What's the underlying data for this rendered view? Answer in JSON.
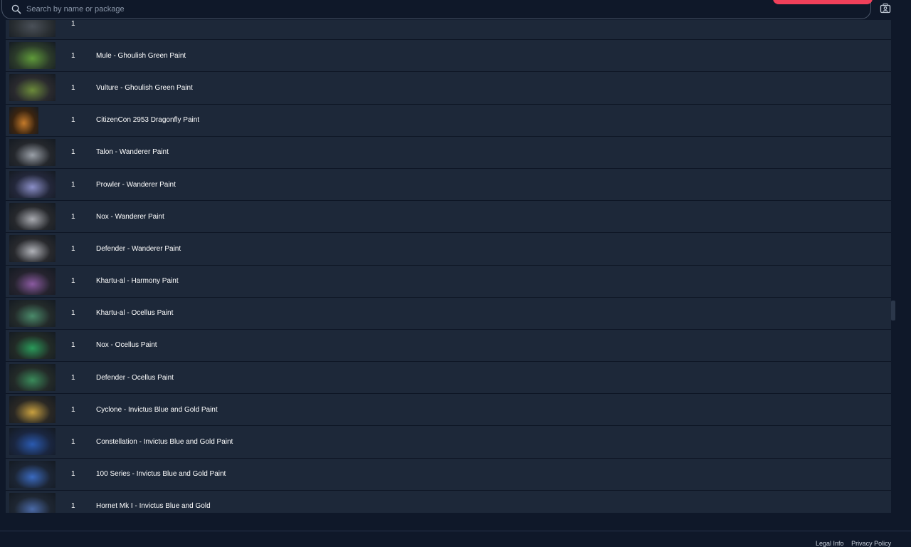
{
  "search": {
    "placeholder": "Search by name or package"
  },
  "colors": {
    "accent": "#f0405a",
    "row_bg": "#1d2839",
    "page_bg": "#0f1829"
  },
  "icons": {
    "search": "search-icon",
    "profile": "profile-card-icon"
  },
  "items": [
    {
      "qty": "1",
      "name": "",
      "thumb": [
        "#2a2f33",
        "#4a5058"
      ]
    },
    {
      "qty": "1",
      "name": "Mule - Ghoulish Green Paint",
      "thumb": [
        "#2b3a2a",
        "#5f9a3a"
      ]
    },
    {
      "qty": "1",
      "name": "Vulture - Ghoulish Green Paint",
      "thumb": [
        "#2a2a2e",
        "#6b8a3a"
      ]
    },
    {
      "qty": "1",
      "name": "CitizenCon 2953 Dragonfly Paint",
      "thumb": [
        "#3a2410",
        "#c47a2a"
      ]
    },
    {
      "qty": "1",
      "name": "Talon - Wanderer Paint",
      "thumb": [
        "#24272c",
        "#9aa0a8"
      ]
    },
    {
      "qty": "1",
      "name": "Prowler - Wanderer Paint",
      "thumb": [
        "#23273a",
        "#8b8fc8"
      ]
    },
    {
      "qty": "1",
      "name": "Nox - Wanderer Paint",
      "thumb": [
        "#26282c",
        "#a8aab0"
      ]
    },
    {
      "qty": "1",
      "name": "Defender - Wanderer Paint",
      "thumb": [
        "#28292d",
        "#b0b2b8"
      ]
    },
    {
      "qty": "1",
      "name": "Khartu-al - Harmony Paint",
      "thumb": [
        "#25232e",
        "#8a5aa0"
      ]
    },
    {
      "qty": "1",
      "name": "Khartu-al - Ocellus Paint",
      "thumb": [
        "#232a2a",
        "#4a8a6a"
      ]
    },
    {
      "qty": "1",
      "name": "Nox - Ocellus Paint",
      "thumb": [
        "#222a26",
        "#2a9a5a"
      ]
    },
    {
      "qty": "1",
      "name": "Defender - Ocellus Paint",
      "thumb": [
        "#232a28",
        "#3a8a5a"
      ]
    },
    {
      "qty": "1",
      "name": "Cyclone - Invictus Blue and Gold Paint",
      "thumb": [
        "#2a2824",
        "#c8a040"
      ]
    },
    {
      "qty": "1",
      "name": "Constellation - Invictus Blue and Gold Paint",
      "thumb": [
        "#1a2640",
        "#2a5ab0"
      ]
    },
    {
      "qty": "1",
      "name": "100 Series - Invictus Blue and Gold Paint",
      "thumb": [
        "#1c2534",
        "#3a6ac0"
      ]
    },
    {
      "qty": "1",
      "name": "Hornet Mk I - Invictus Blue and Gold",
      "thumb": [
        "#1e2632",
        "#4a6aa8"
      ]
    }
  ],
  "footer": {
    "links": [
      "Legal Info",
      "Privacy Policy"
    ]
  }
}
